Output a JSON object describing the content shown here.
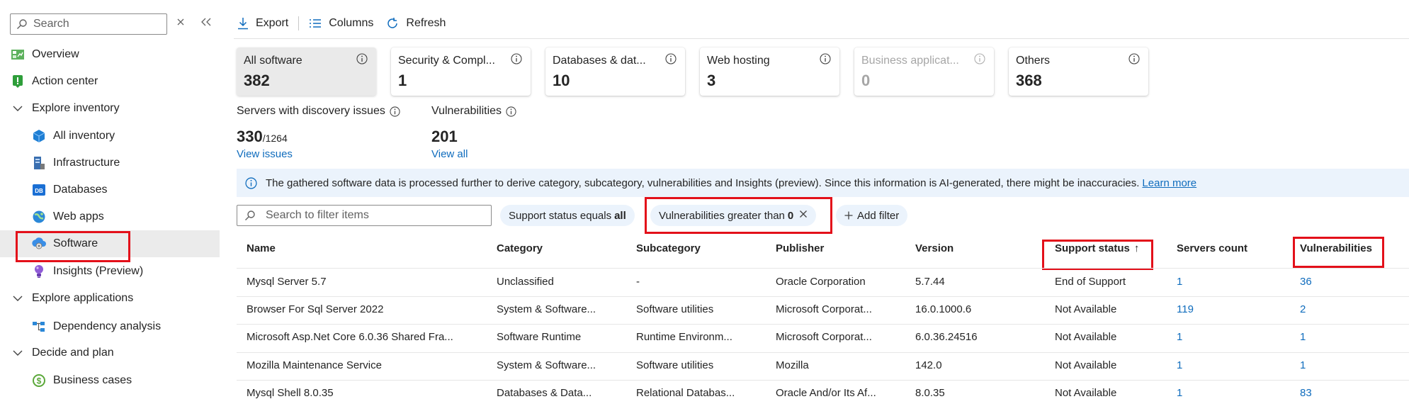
{
  "sidebar": {
    "search_placeholder": "Search",
    "items": [
      {
        "label": "Overview"
      },
      {
        "label": "Action center"
      },
      {
        "label": "Explore inventory"
      },
      {
        "label": "All inventory"
      },
      {
        "label": "Infrastructure"
      },
      {
        "label": "Databases"
      },
      {
        "label": "Web apps"
      },
      {
        "label": "Software"
      },
      {
        "label": "Insights (Preview)"
      },
      {
        "label": "Explore applications"
      },
      {
        "label": "Dependency analysis"
      },
      {
        "label": "Decide and plan"
      },
      {
        "label": "Business cases"
      }
    ],
    "db_badge": "DB"
  },
  "toolbar": {
    "export": "Export",
    "columns": "Columns",
    "refresh": "Refresh"
  },
  "cards": [
    {
      "title": "All software",
      "count": "382"
    },
    {
      "title": "Security & Compl...",
      "count": "1"
    },
    {
      "title": "Databases & dat...",
      "count": "10"
    },
    {
      "title": "Web hosting",
      "count": "3"
    },
    {
      "title": "Business applicat...",
      "count": "0"
    },
    {
      "title": "Others",
      "count": "368"
    }
  ],
  "stats": {
    "servers_label": "Servers with discovery issues",
    "servers_value": "330",
    "servers_total": "/1264",
    "servers_link": "View issues",
    "vuln_label": "Vulnerabilities",
    "vuln_value": "201",
    "vuln_link": "View all"
  },
  "info_bar": {
    "text": "The gathered software data is processed further to derive category, subcategory, vulnerabilities and Insights (preview). Since this information is AI-generated, there might be inaccuracies.",
    "link": "Learn more"
  },
  "filters": {
    "search_placeholder": "Search to filter items",
    "pill1_prefix": "Support status equals",
    "pill1_value": "all",
    "pill2_prefix": "Vulnerabilities greater than",
    "pill2_value": "0",
    "add_filter": "Add filter"
  },
  "table": {
    "headers": [
      "Name",
      "Category",
      "Subcategory",
      "Publisher",
      "Version",
      "Support status",
      "Servers count",
      "Vulnerabilities"
    ],
    "sort_arrow": "↑",
    "rows": [
      [
        "Mysql Server 5.7",
        "Unclassified",
        "-",
        "Oracle Corporation",
        "5.7.44",
        "End of Support",
        "1",
        "36"
      ],
      [
        "Browser For Sql Server 2022",
        "System & Software...",
        "Software utilities",
        "Microsoft Corporat...",
        "16.0.1000.6",
        "Not Available",
        "119",
        "2"
      ],
      [
        "Microsoft Asp.Net Core 6.0.36 Shared Fra...",
        "Software Runtime",
        "Runtime Environm...",
        "Microsoft Corporat...",
        "6.0.36.24516",
        "Not Available",
        "1",
        "1"
      ],
      [
        "Mozilla Maintenance Service",
        "System & Software...",
        "Software utilities",
        "Mozilla",
        "142.0",
        "Not Available",
        "1",
        "1"
      ],
      [
        "Mysql Shell 8.0.35",
        "Databases & Data...",
        "Relational Databas...",
        "Oracle And/or Its Af...",
        "8.0.35",
        "Not Available",
        "1",
        "83"
      ]
    ]
  }
}
